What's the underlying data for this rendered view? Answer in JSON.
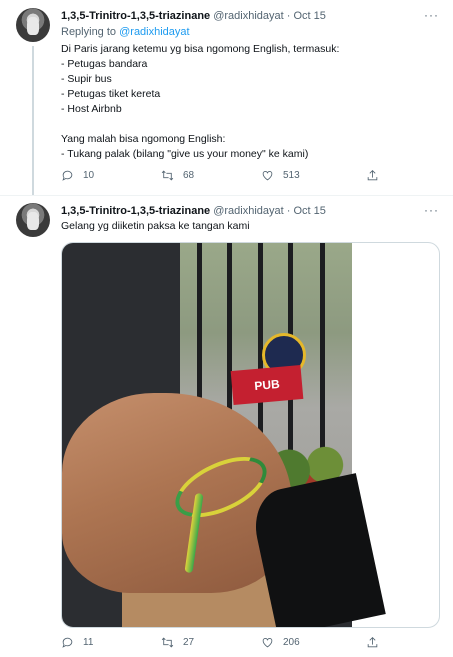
{
  "tweets": [
    {
      "name": "1,3,5-Trinitro-1,3,5-triazinane",
      "handle": "@radixhidayat",
      "sep": "·",
      "date": "Oct 15",
      "more": "···",
      "replying_prefix": "Replying to",
      "replying_handle": "@radixhidayat",
      "lines": [
        "Di Paris jarang ketemu yg bisa ngomong English, termasuk:",
        "- Petugas bandara",
        "- Supir bus",
        "- Petugas tiket kereta",
        "- Host Airbnb",
        "",
        "Yang malah bisa ngomong English:",
        "- Tukang palak (bilang \"give us your money\" ke kami)"
      ],
      "replies": "10",
      "retweets": "68",
      "likes": "513"
    },
    {
      "name": "1,3,5-Trinitro-1,3,5-triazinane",
      "handle": "@radixhidayat",
      "sep": "·",
      "date": "Oct 15",
      "more": "···",
      "text": "Gelang yg diiketin paksa ke tangan kami",
      "photo_sign": "PUB",
      "replies": "11",
      "retweets": "27",
      "likes": "206"
    }
  ],
  "icons": {
    "reply": "reply-icon",
    "retweet": "retweet-icon",
    "like": "heart-icon",
    "share": "share-icon"
  }
}
